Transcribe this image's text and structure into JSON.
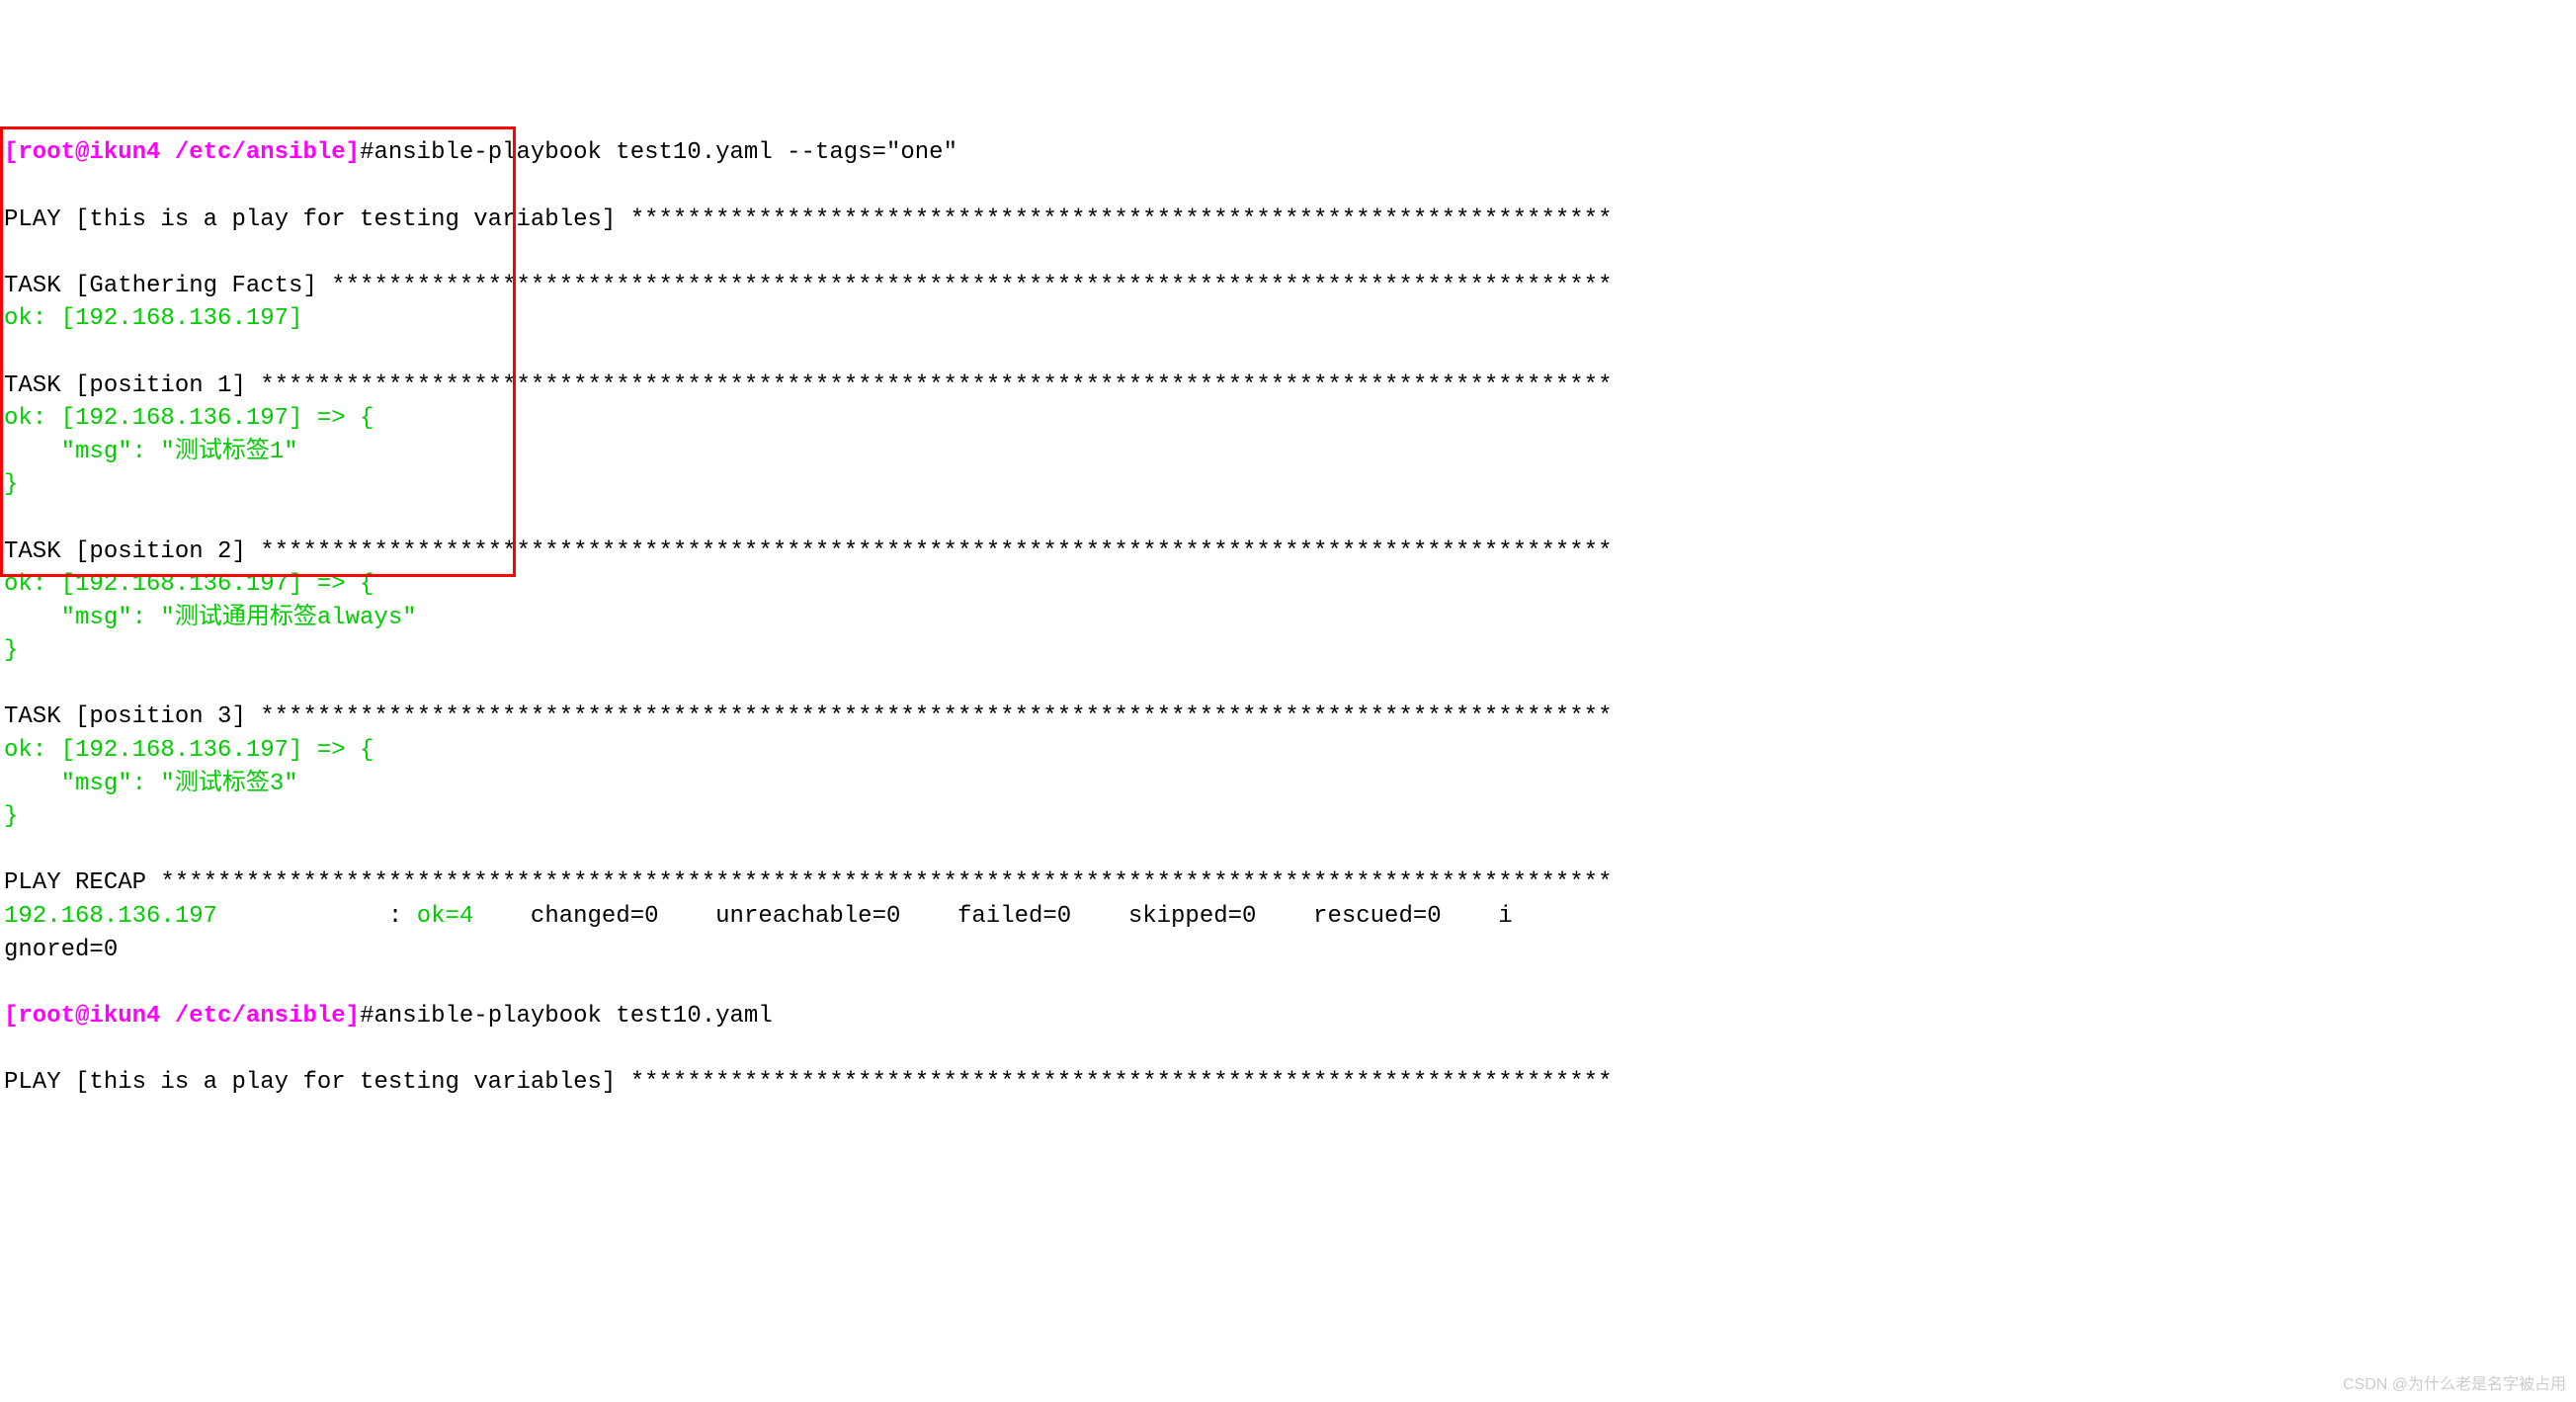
{
  "prompt1": {
    "user": "[root@ikun4 /etc/ansible]",
    "hash": "#",
    "command": "ansible-playbook test10.yaml --tags=\"one\""
  },
  "play": {
    "header": "PLAY [this is a play for testing variables] *********************************************************************",
    "gather": "TASK [Gathering Facts] ******************************************************************************************",
    "gather_ok": "ok: [192.168.136.197]",
    "task1": "TASK [position 1] ***********************************************************************************************",
    "task1_ok1": "ok: [192.168.136.197] => {",
    "task1_ok2": "    \"msg\": \"测试标签1\"",
    "task1_ok3": "}",
    "task2": "TASK [position 2] ***********************************************************************************************",
    "task2_ok1": "ok: [192.168.136.197] => {",
    "task2_ok2": "    \"msg\": \"测试通用标签always\"",
    "task2_ok3": "}",
    "task3": "TASK [position 3] ***********************************************************************************************",
    "task3_ok1": "ok: [192.168.136.197] => {",
    "task3_ok2": "    \"msg\": \"测试标签3\"",
    "task3_ok3": "}",
    "recap_header": "PLAY RECAP ******************************************************************************************************",
    "recap_host": "192.168.136.197",
    "recap_sep": "            : ",
    "recap_ok": "ok=4   ",
    "recap_rest1": " changed=0    unreachable=0    failed=0    skipped=0    rescued=0    i",
    "recap_rest2": "gnored=0"
  },
  "prompt2": {
    "user": "[root@ikun4 /etc/ansible]",
    "hash": "#",
    "command": "ansible-playbook test10.yaml"
  },
  "play2_header": "PLAY [this is a play for testing variables] *********************************************************************",
  "watermark": "CSDN @为什么老是名字被占用"
}
